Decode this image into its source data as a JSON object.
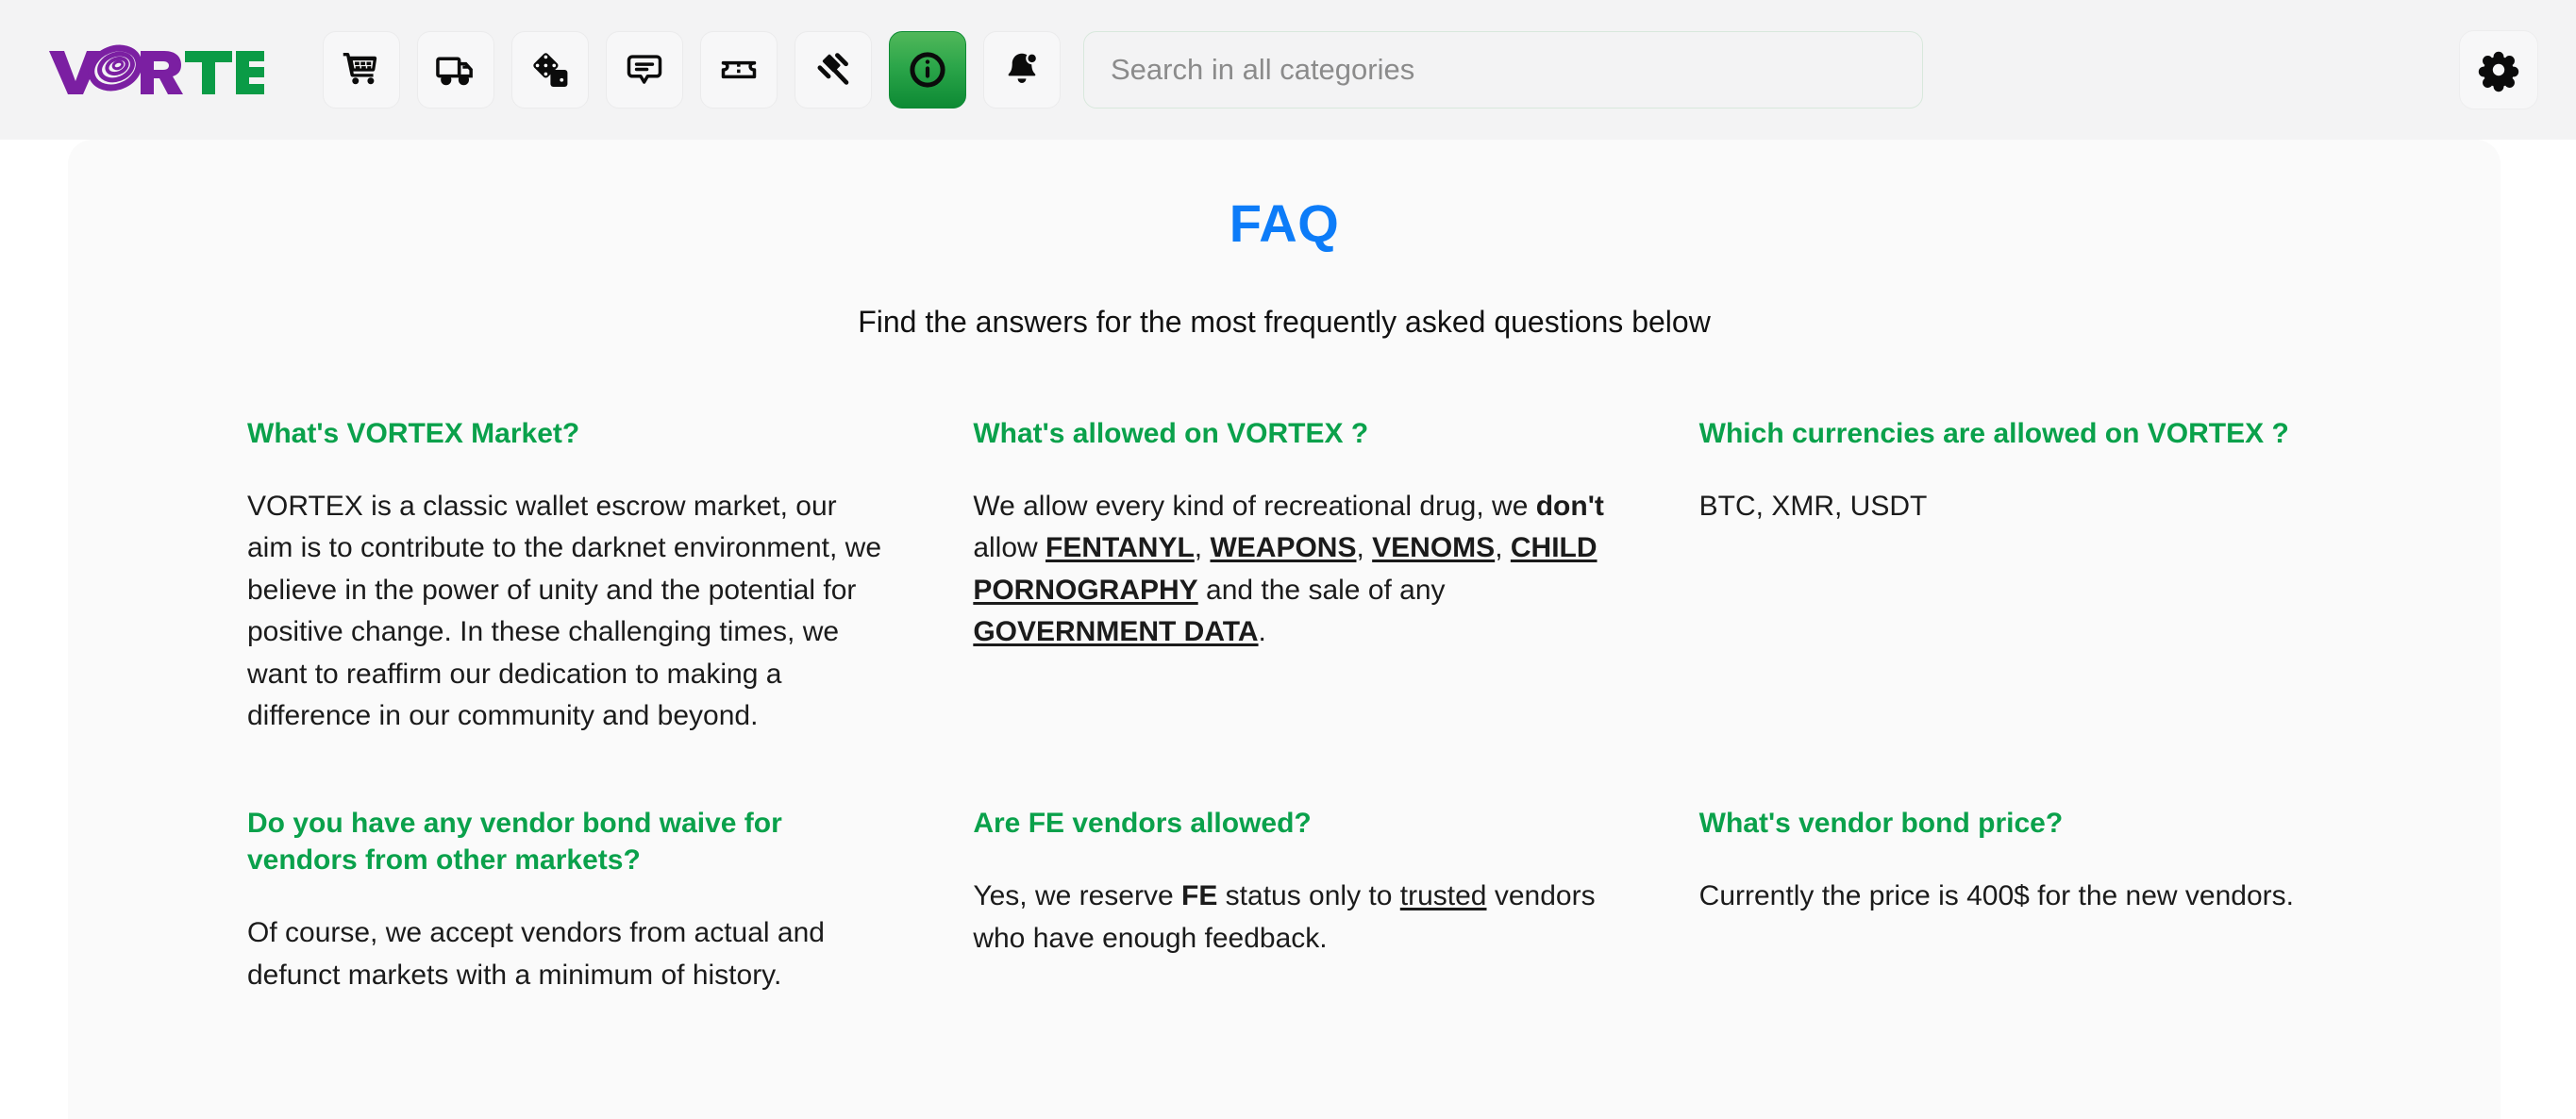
{
  "header": {
    "logo": {
      "text_part1": "VOR",
      "text_part2": "TEX",
      "purple": "#7b1fa2",
      "green": "#0a9b46"
    },
    "nav_icons": [
      {
        "name": "shopping-cart-icon",
        "label": "Cart",
        "active": false
      },
      {
        "name": "delivery-truck-icon",
        "label": "Orders / Shipping",
        "active": false
      },
      {
        "name": "dice-icon",
        "label": "Games",
        "active": false
      },
      {
        "name": "chat-bubble-icon",
        "label": "Messages",
        "active": false
      },
      {
        "name": "ticket-icon",
        "label": "Tickets",
        "active": false
      },
      {
        "name": "gavel-icon",
        "label": "Auctions / Disputes",
        "active": false
      },
      {
        "name": "info-circle-icon",
        "label": "Info / FAQ",
        "active": true
      },
      {
        "name": "bell-icon",
        "label": "Notifications",
        "active": false
      }
    ],
    "search": {
      "placeholder": "Search in all categories",
      "value": ""
    },
    "settings": {
      "icon": "gear-icon",
      "label": "Settings"
    }
  },
  "page": {
    "title": "FAQ",
    "title_color": "#0d7cf8",
    "subtitle": "Find the answers for the most frequently asked questions below",
    "accent_green": "#0aa14b"
  },
  "faq": [
    {
      "question": "What's VORTEX Market?",
      "answer_html": "VORTEX is a classic wallet escrow market, our aim is to contribute to the darknet environment, we believe in the power of unity and the potential for positive change. In these challenging times, we want to reaffirm our dedication to making a difference in our community and beyond.",
      "answer_text": "VORTEX is a classic wallet escrow market, our aim is to contribute to the darknet environment, we believe in the power of unity and the potential for positive change. In these challenging times, we want to reaffirm our dedication to making a difference in our community and beyond."
    },
    {
      "question": "What's allowed on VORTEX ?",
      "answer_html": "We allow every kind of recreational drug, we <b>don't</b> allow <span class=\"bu\">FENTANYL</span>, <span class=\"bu\">WEAPONS</span>, <span class=\"bu\">VENOMS</span>, <span class=\"bu\">CHILD PORNOGRAPHY</span> and the sale of any <span class=\"bu\">GOVERNMENT DATA</span>.",
      "answer_text": "We allow every kind of recreational drug, we don't allow FENTANYL, WEAPONS, VENOMS, CHILD PORNOGRAPHY and the sale of any GOVERNMENT DATA."
    },
    {
      "question": "Which currencies are allowed on VORTEX ?",
      "answer_html": "BTC, XMR, USDT",
      "answer_text": "BTC, XMR, USDT"
    },
    {
      "question": "Do you have any vendor bond waive for vendors from other markets?",
      "answer_html": "Of course, we accept vendors from actual and defunct markets with a minimum of history.",
      "answer_text": "Of course, we accept vendors from actual and defunct markets with a minimum of history."
    },
    {
      "question": "Are FE vendors allowed?",
      "answer_html": "Yes, we reserve <b>FE</b> status only to <u>trusted</u> vendors who have enough feedback.",
      "answer_text": "Yes, we reserve FE status only to trusted vendors who have enough feedback."
    },
    {
      "question": "What's vendor bond price?",
      "answer_html": "Currently the price is 400$ for the new vendors.",
      "answer_text": "Currently the price is 400$ for the new vendors."
    }
  ]
}
